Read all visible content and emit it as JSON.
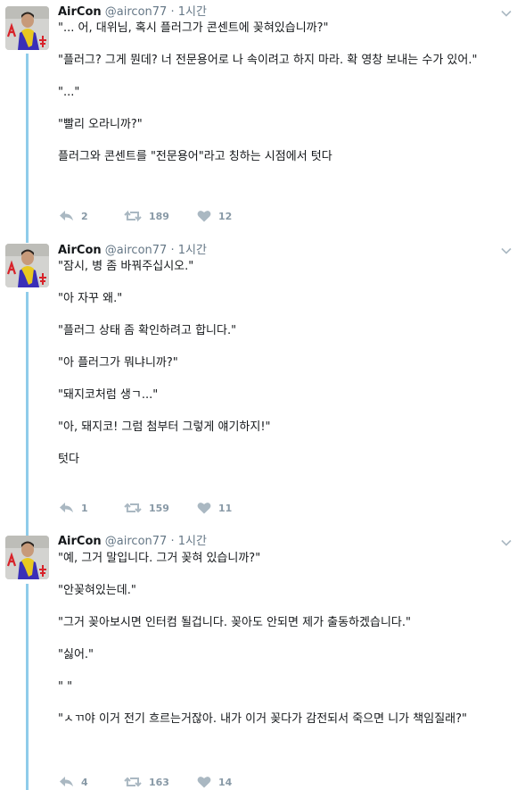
{
  "tweets": [
    {
      "author": "AirCon",
      "handle": "@aircon77",
      "sep": "·",
      "time": "1시간",
      "paragraphs": [
        "\"... 어, 대위님, 혹시 플러그가 콘센트에 꽂혀있습니까?\"",
        "\"플러그? 그게 뭔데? 너 전문용어로 나 속이려고 하지 마라. 확 영창 보내는 수가 있어.\"",
        "\"...\"",
        "\"빨리 오라니까?\"",
        "플러그와 콘센트를 \"전문용어\"라고 칭하는 시점에서 텃다"
      ],
      "replies": "2",
      "retweets": "189",
      "likes": "12"
    },
    {
      "author": "AirCon",
      "handle": "@aircon77",
      "sep": "·",
      "time": "1시간",
      "paragraphs": [
        "\"잠시, 병 좀 바꿔주십시오.\"",
        "\"아 자꾸 왜.\"",
        "\"플러그 상태 좀 확인하려고 합니다.\"",
        "\"아 플러그가 뭐냐니까?\"",
        "\"돼지코처럼 생ㄱ...\"",
        "\"아, 돼지코! 그럼 첨부터 그렇게 얘기하지!\"",
        "텃다"
      ],
      "replies": "1",
      "retweets": "159",
      "likes": "11"
    },
    {
      "author": "AirCon",
      "handle": "@aircon77",
      "sep": "·",
      "time": "1시간",
      "paragraphs": [
        "\"예, 그거 말입니다. 그거 꽂혀 있습니까?\"",
        "\"안꽂혀있는데.\"",
        "\"그거 꽂아보시면 인터컴 될겁니다. 꽂아도 안되면 제가 출동하겠습니다.\"",
        "\"싫어.\"",
        "\" \"",
        "\"ㅅㄲ야 이거 전기 흐르는거잖아. 내가 이거 꽂다가 감전되서 죽으면 니가 책임질래?\""
      ],
      "replies": "4",
      "retweets": "163",
      "likes": "14"
    }
  ],
  "colors": {
    "thread_line": "#8fccea",
    "meta": "#657786",
    "action_icon": "#aab8c2",
    "avatar_shirt": "#3a2fb8",
    "avatar_scarf": "#e8c820",
    "avatar_mark": "#d8232a"
  },
  "icons": {
    "reply": "reply-icon",
    "retweet": "retweet-icon",
    "like": "heart-icon",
    "menu": "chevron-down-icon"
  }
}
